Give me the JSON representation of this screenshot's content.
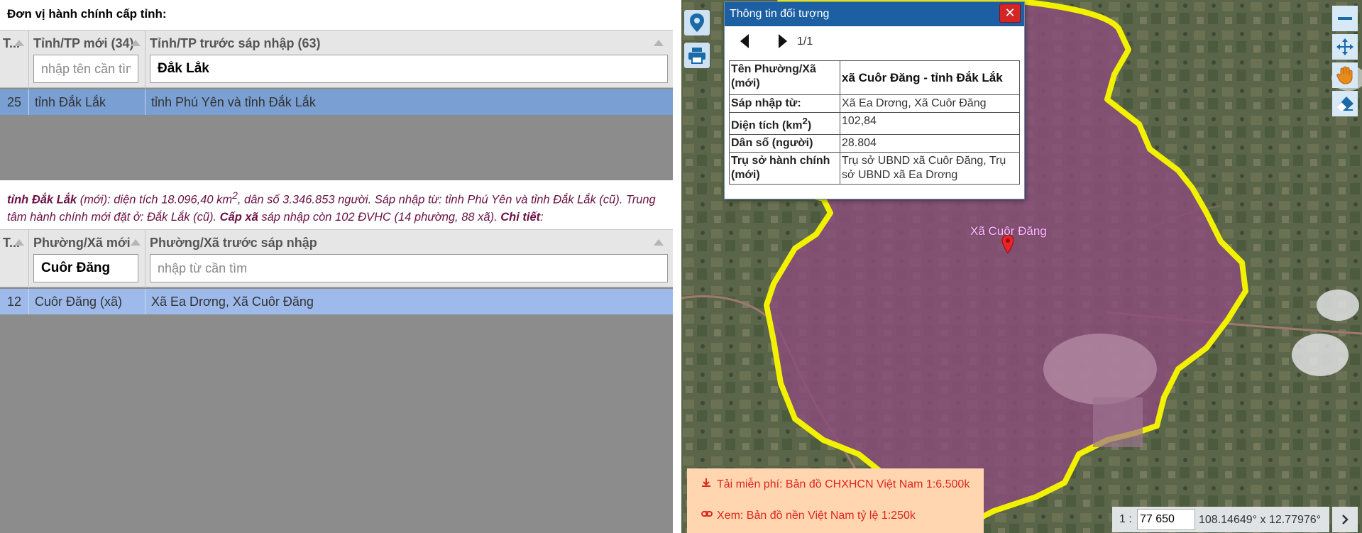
{
  "left": {
    "title": "Đơn vị hành chính cấp tỉnh:",
    "province_grid": {
      "col_idx": "T...",
      "col_new": "Tỉnh/TP mới (34)",
      "col_old": "Tỉnh/TP trước sáp nhập (63)",
      "filter_new_placeholder": "nhập tên cần tìm",
      "filter_old_value": "Đắk Lắk",
      "row": {
        "idx": "25",
        "new": "tỉnh Đắk Lắk",
        "old": "tỉnh Phú Yên và tỉnh Đắk Lắk"
      }
    },
    "summary": {
      "name": "tỉnh Đắk Lắk",
      "text1": " (mới): diện tích 18.096,40 km",
      "sup": "2",
      "text2": ", dân số 3.346.853 người. Sáp nhập từ: tỉnh Phú Yên và tỉnh Đắk Lắk (cũ). Trung tâm hành chính mới đặt ở: Đắk Lắk (cũ). ",
      "cap_xa": "Cấp xã",
      "text3": " sáp nhập còn 102 ĐVHC (14 phường, 88 xã). ",
      "chi_tiet": "Chi tiết",
      "colon": ":"
    },
    "commune_grid": {
      "col_idx": "T...",
      "col_new": "Phường/Xã mới",
      "col_old": "Phường/Xã trước sáp nhập",
      "filter_new_value": "Cuôr Đăng",
      "filter_old_placeholder": "nhập từ cần tìm",
      "row": {
        "idx": "12",
        "new": "Cuôr Đăng (xã)",
        "old": "Xã Ea Drơng, Xã Cuôr Đăng"
      }
    }
  },
  "popup": {
    "title": "Thông tin đối tượng",
    "close": "✕",
    "count": "1/1",
    "rows": [
      {
        "key": "Tên Phường/Xã (mới)",
        "value": "xã Cuôr Đăng - tỉnh Đắk Lắk"
      },
      {
        "key": "Sáp nhập từ:",
        "value": "Xã Ea Drơng, Xã Cuôr Đăng"
      },
      {
        "key": "Diện tích (km",
        "key_sup": "2",
        "key_end": ")",
        "value": "102,84"
      },
      {
        "key": "Dân số (người)",
        "value": "28.804"
      },
      {
        "key": "Trụ sở hành chính (mới)",
        "value": "Trụ sở UBND xã Cuôr Đăng, Trụ sở UBND xã Ea Drơng"
      }
    ]
  },
  "map": {
    "marker_label": "Xã Cuôr Đăng",
    "download_link": "Tải miễn phí: Bản đồ CHXHCN Việt Nam 1:6.500k",
    "view_link": "Xem: Bản đồ nền Việt Nam tỷ lệ 1:250k",
    "scale_prefix": "1 :",
    "scale_value": "77 650",
    "coords": "108.14649° x 12.77976°"
  },
  "colors": {
    "accent": "#1d5fa3",
    "boundary": "#f2f200",
    "region_fill": "#8a4e79",
    "selected_row_1": "#7a9fd3",
    "selected_row_2": "#9dbaea",
    "summary_text": "#6b1045",
    "link_red": "#e0261c"
  },
  "icons": [
    "location-pin-icon",
    "print-icon",
    "zoom-out-icon",
    "pan-icon",
    "hand-icon",
    "eraser-icon",
    "download-icon",
    "link-icon",
    "chevron-right-icon"
  ]
}
